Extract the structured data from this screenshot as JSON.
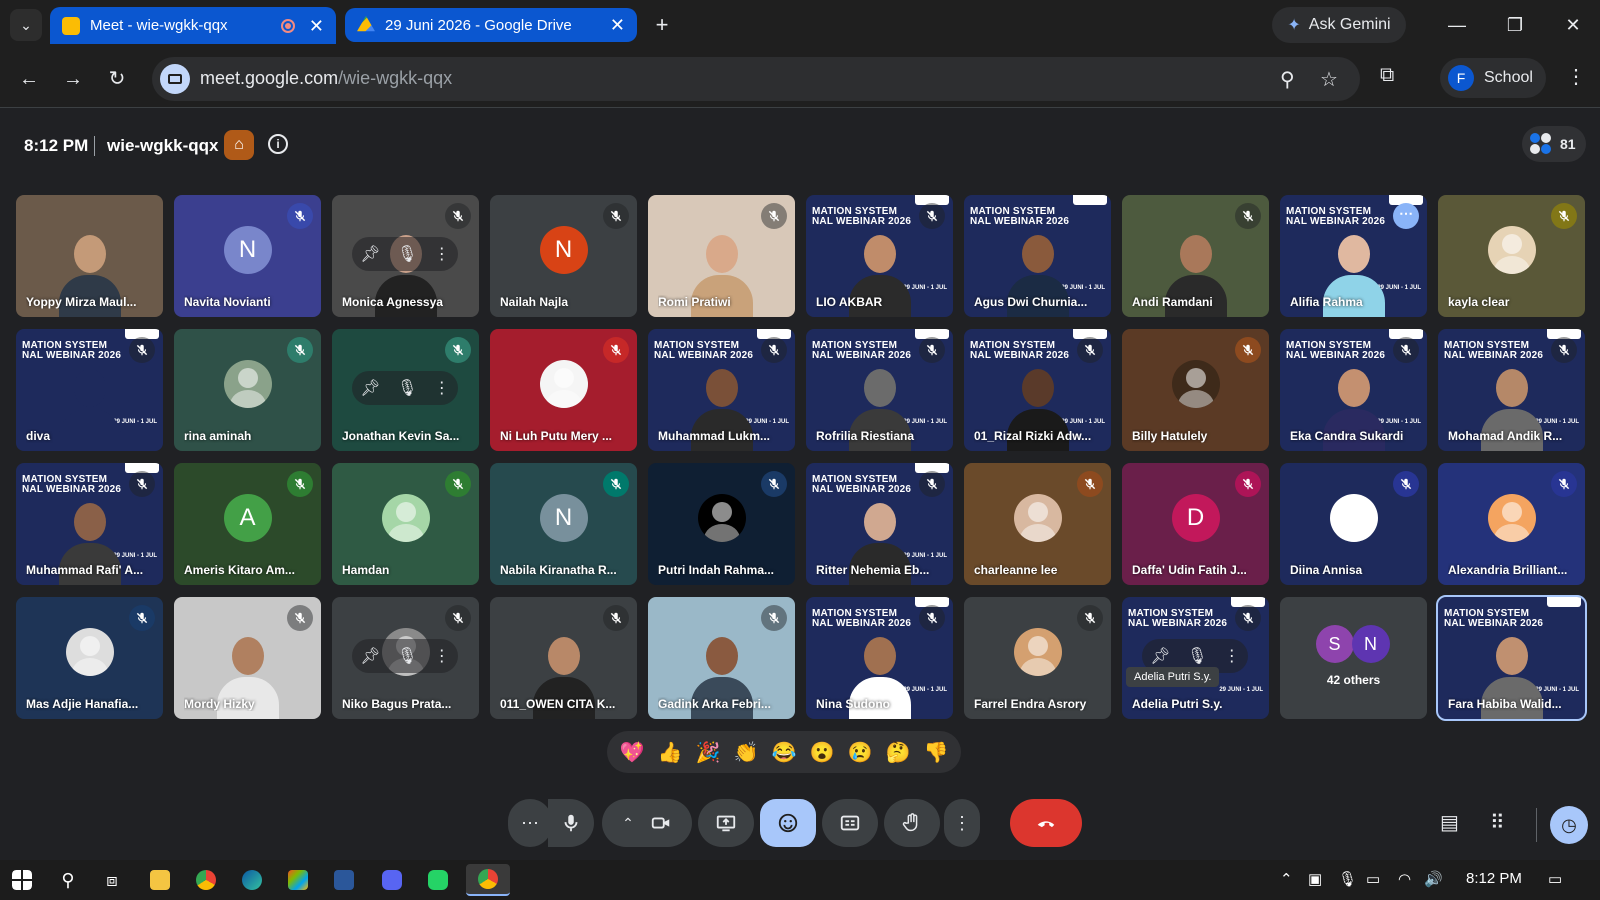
{
  "browser": {
    "tabs": [
      {
        "title": "Meet - wie-wgkk-qqx",
        "recording": true,
        "fav_color": "#fbbc04"
      },
      {
        "title": "29 Juni 2026 - Google Drive",
        "fav_color": "#34a853"
      }
    ],
    "ask_gemini": "Ask Gemini",
    "url_domain": "meet.google.com",
    "url_path": "/wie-wgkk-qqx",
    "profile_initial": "F",
    "profile_name": "School"
  },
  "meet": {
    "time": "8:12 PM",
    "meeting_code": "wie-wgkk-qqx",
    "participant_count": "81"
  },
  "banner": {
    "title_line1": "MATION SYSTEM",
    "title_line2": "NAL WEBINAR 2026",
    "date": "29 JUNI - 1 JUL"
  },
  "tiles": [
    {
      "name": "Yoppy Mirza Maul...",
      "type": "video",
      "bg": "#6b5a4a",
      "skin": "#c49a78",
      "cloth": "#2f3a48",
      "muted": false
    },
    {
      "name": "Navita Novianti",
      "type": "initial",
      "initial": "N",
      "avatar_color": "#7986cb",
      "bg": "#3b3f8f",
      "muted": true,
      "mic_bg": "#3949ab"
    },
    {
      "name": "Monica Agnessya",
      "type": "hover",
      "bg": "#4a4a4a",
      "skin": "#c9a08a",
      "cloth": "#222",
      "muted": true
    },
    {
      "name": "Nailah Najla",
      "type": "initial",
      "initial": "N",
      "avatar_color": "#d84315",
      "bg": "#3c4043",
      "muted": true
    },
    {
      "name": "Romi Pratiwi",
      "type": "video",
      "bg": "#d8c8b8",
      "skin": "#d9a98a",
      "cloth": "#c9a27a",
      "muted": true
    },
    {
      "name": "LIO AKBAR",
      "type": "banner",
      "bg": "#1e2a5c",
      "skin": "#c08c6a",
      "cloth": "#2b2b2b",
      "muted": true
    },
    {
      "name": "Agus Dwi Churnia...",
      "type": "banner",
      "bg": "#1e2a5c",
      "skin": "#8a5a3c",
      "cloth": "#1b2b44",
      "muted": false
    },
    {
      "name": "Andi Ramdani",
      "type": "video",
      "bg": "#4d5a3e",
      "skin": "#a9785a",
      "cloth": "#2a2a2a",
      "muted": true
    },
    {
      "name": "Alifia Rahma",
      "type": "banner",
      "bg": "#1e2a5c",
      "skin": "#e0b8a0",
      "cloth": "#8fd3e8",
      "muted": false,
      "more": true
    },
    {
      "name": "kayla clear",
      "type": "photo",
      "bg": "#5a5838",
      "photo_color": "#e6d3b5",
      "muted": true,
      "mic_bg": "#827717"
    },
    {
      "name": "diva",
      "type": "banner",
      "bg": "#1e2a5c",
      "skin": "#1e2a5c",
      "cloth": "#1e2a5c",
      "muted": true
    },
    {
      "name": "rina aminah",
      "type": "photo",
      "bg": "#2f5148",
      "photo_color": "#8aa28a",
      "muted": true,
      "mic_bg": "#2e7d6b"
    },
    {
      "name": "Jonathan Kevin Sa...",
      "type": "hovernp",
      "bg": "#1e4a40",
      "muted": true,
      "mic_bg": "#2e7d6b"
    },
    {
      "name": "Ni Luh Putu Mery ...",
      "type": "photo",
      "bg": "#a51d2d",
      "photo_color": "#f5f5f5",
      "muted": true,
      "mic_bg": "#c62828"
    },
    {
      "name": "Muhammad Lukm...",
      "type": "banner",
      "bg": "#1e2a5c",
      "skin": "#7a5038",
      "cloth": "#2a2a2a",
      "muted": true
    },
    {
      "name": "Rofrilia Riestiana",
      "type": "banner",
      "bg": "#1e2a5c",
      "skin": "#6b6b6b",
      "cloth": "#3a3a3a",
      "muted": true
    },
    {
      "name": "01_Rizal Rizki Adw...",
      "type": "banner",
      "bg": "#1e2a5c",
      "skin": "#5a3a2a",
      "cloth": "#1a1a1a",
      "muted": true
    },
    {
      "name": "Billy Hatulely",
      "type": "photo",
      "bg": "#5b3a25",
      "photo_color": "#3e2a1a",
      "muted": true,
      "mic_bg": "#8d4a1f"
    },
    {
      "name": "Eka Candra Sukardi",
      "type": "banner",
      "bg": "#1e2a5c",
      "skin": "#c49070",
      "cloth": "#2a2a60",
      "muted": true
    },
    {
      "name": "Mohamad Andik R...",
      "type": "banner",
      "bg": "#1e2a5c",
      "skin": "#b58868",
      "cloth": "#6a6a6a",
      "muted": true
    },
    {
      "name": "Muhammad Rafi' A...",
      "type": "banner",
      "bg": "#1e2a5c",
      "skin": "#8a6048",
      "cloth": "#3a3a3a",
      "muted": true
    },
    {
      "name": "Ameris Kitaro Am...",
      "type": "initial",
      "initial": "A",
      "avatar_color": "#43a047",
      "bg": "#2c4a2a",
      "muted": true,
      "mic_bg": "#2e7d32"
    },
    {
      "name": "Hamdan",
      "type": "photo",
      "bg": "#2f5a44",
      "photo_color": "#a5d6a7",
      "muted": true,
      "mic_bg": "#2e7d32"
    },
    {
      "name": "Nabila Kiranatha R...",
      "type": "initial",
      "initial": "N",
      "avatar_color": "#78909c",
      "bg": "#264a4e",
      "muted": true,
      "mic_bg": "#00796b"
    },
    {
      "name": "Putri Indah Rahma...",
      "type": "photo",
      "bg": "#0f1f33",
      "photo_color": "#000000",
      "muted": true,
      "mic_bg": "#1a3a66"
    },
    {
      "name": "Ritter Nehemia Eb...",
      "type": "banner",
      "bg": "#1e2a5c",
      "skin": "#d0a890",
      "cloth": "#2a2a2a",
      "muted": true
    },
    {
      "name": "charleanne lee",
      "type": "photo",
      "bg": "#6a4a2a",
      "photo_color": "#d8b8a0",
      "muted": true,
      "mic_bg": "#8d4a1f"
    },
    {
      "name": "Daffa' Udin Fatih J...",
      "type": "initial",
      "initial": "D",
      "avatar_color": "#c2185b",
      "bg": "#6a1f4a",
      "muted": true,
      "mic_bg": "#ad1457"
    },
    {
      "name": "Diina Annisa",
      "type": "photo",
      "bg": "#1e2a5c",
      "photo_color": "#ffffff",
      "muted": true,
      "mic_bg": "#283593"
    },
    {
      "name": "Alexandria Brilliant...",
      "type": "photo",
      "bg": "#24327a",
      "photo_color": "#f4a460",
      "muted": true,
      "mic_bg": "#283593"
    },
    {
      "name": "Mas Adjie Hanafia...",
      "type": "photo",
      "bg": "#1e3456",
      "photo_color": "#dddddd",
      "muted": true,
      "mic_bg": "#1a3a66"
    },
    {
      "name": "Mordy Hizky",
      "type": "video",
      "bg": "#c8c8c8",
      "skin": "#b08060",
      "cloth": "#e8e8e8",
      "muted": true
    },
    {
      "name": "Niko Bagus Prata...",
      "type": "hoverphoto",
      "bg": "#3c4043",
      "photo_color": "#8a8a8a",
      "muted": true
    },
    {
      "name": "011_OWEN CITA K...",
      "type": "video",
      "bg": "#3c4043",
      "skin": "#b88868",
      "cloth": "#222222",
      "muted": true
    },
    {
      "name": "Gadink Arka Febri...",
      "type": "video",
      "bg": "#9ab8c8",
      "skin": "#8a5a40",
      "cloth": "#3a4a5a",
      "muted": true
    },
    {
      "name": "Nina Sudono",
      "type": "banner",
      "bg": "#1e2a5c",
      "skin": "#a07050",
      "cloth": "#ffffff",
      "muted": true
    },
    {
      "name": "Farrel Endra Asrory",
      "type": "photo",
      "bg": "#3c4043",
      "photo_color": "#d4a070",
      "muted": true
    },
    {
      "name": "Adelia Putri S.y.",
      "type": "tooltip",
      "bg": "#1e2a5c",
      "muted": true,
      "tooltip": "Adelia Putri S.y."
    },
    {
      "name": "42 others",
      "type": "others",
      "bg": "#3c4043",
      "initials": [
        "S",
        "N"
      ],
      "colors": [
        "#8e44ad",
        "#5e35b1"
      ]
    },
    {
      "name": "Fara Habiba Walid...",
      "type": "banner",
      "bg": "#1e2a5c",
      "skin": "#c09070",
      "cloth": "#6a6a6a",
      "muted": false,
      "selected": true
    }
  ],
  "reactions": [
    "💖",
    "👍",
    "🎉",
    "👏",
    "😂",
    "😮",
    "😢",
    "🤔",
    "👎"
  ],
  "taskbar": {
    "clock": "8:12 PM"
  }
}
